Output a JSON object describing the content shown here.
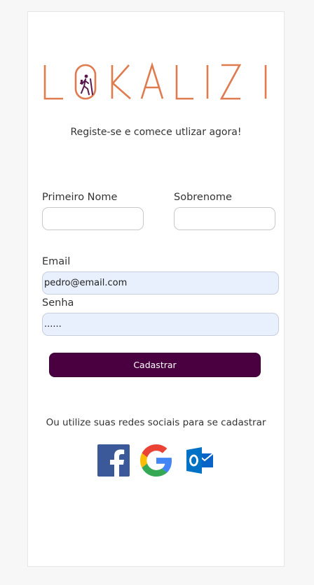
{
  "brand": {
    "name": "LOKALIZI",
    "color": "#e07a4f",
    "icon_color": "#5a1a50"
  },
  "tagline": "Registe-se e comece utlizar agora!",
  "form": {
    "first_name_label": "Primeiro Nome",
    "first_name_value": "",
    "last_name_label": "Sobrenome",
    "last_name_value": "",
    "email_label": "Email",
    "email_value": "pedro@email.com",
    "password_label": "Senha",
    "password_value": "......",
    "submit_label": "Cadastrar",
    "submit_color": "#4a0040"
  },
  "social": {
    "text": "Ou utilize suas redes sociais para se cadastrar",
    "items": [
      {
        "icon": "facebook-icon"
      },
      {
        "icon": "google-icon"
      },
      {
        "icon": "outlook-icon"
      }
    ]
  }
}
